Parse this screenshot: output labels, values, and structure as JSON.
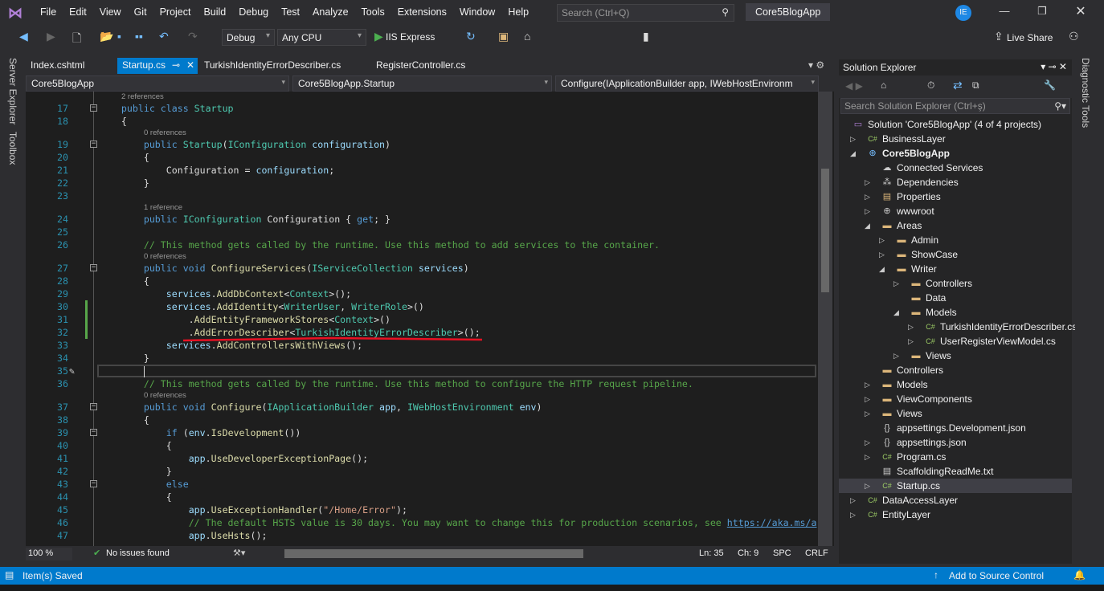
{
  "titlebar": {
    "menu": [
      "File",
      "Edit",
      "View",
      "Git",
      "Project",
      "Build",
      "Debug",
      "Test",
      "Analyze",
      "Tools",
      "Extensions",
      "Window",
      "Help"
    ],
    "search_placeholder": "Search (Ctrl+Q)",
    "app_title": "Core5BlogApp",
    "avatar": "IE"
  },
  "toolbar": {
    "config": "Debug",
    "platform": "Any CPU",
    "run": "IIS Express",
    "live_share": "Live Share"
  },
  "left_strip": [
    "Server Explorer",
    "Toolbox"
  ],
  "tabs": [
    {
      "label": "Index.cshtml"
    },
    {
      "label": "Startup.cs",
      "active": true
    },
    {
      "label": "TurkishIdentityErrorDescriber.cs"
    },
    {
      "label": "RegisterController.cs"
    }
  ],
  "navbar": {
    "project": "Core5BlogApp",
    "type": "Core5BlogApp.Startup",
    "member": "Configure(IApplicationBuilder app, IWebHostEnvironm"
  },
  "code": [
    {
      "lens": "2 references"
    },
    {
      "n": "17",
      "fold": true,
      "code": [
        [
          "p",
          "    "
        ],
        [
          "k",
          "public class "
        ],
        [
          "t",
          "Startup"
        ]
      ]
    },
    {
      "n": "18",
      "code": [
        [
          "p",
          "    {"
        ]
      ]
    },
    {
      "lens": "0 references",
      "indent": 8
    },
    {
      "n": "19",
      "fold": true,
      "code": [
        [
          "p",
          "        "
        ],
        [
          "k",
          "public "
        ],
        [
          "t",
          "Startup"
        ],
        [
          "p",
          "("
        ],
        [
          "t",
          "IConfiguration"
        ],
        [
          "p",
          " "
        ],
        [
          "v",
          "configuration"
        ],
        [
          "p",
          ")"
        ]
      ]
    },
    {
      "n": "20",
      "code": [
        [
          "p",
          "        {"
        ]
      ]
    },
    {
      "n": "21",
      "code": [
        [
          "p",
          "            "
        ],
        [
          "p",
          "Configuration"
        ],
        [
          "p",
          " = "
        ],
        [
          "v",
          "configuration"
        ],
        [
          "p",
          ";"
        ]
      ]
    },
    {
      "n": "22",
      "code": [
        [
          "p",
          "        }"
        ]
      ]
    },
    {
      "n": "23",
      "code": []
    },
    {
      "lens": "1 reference",
      "indent": 8
    },
    {
      "n": "24",
      "code": [
        [
          "p",
          "        "
        ],
        [
          "k",
          "public "
        ],
        [
          "t",
          "IConfiguration"
        ],
        [
          "p",
          " Configuration { "
        ],
        [
          "k",
          "get"
        ],
        [
          "p",
          "; }"
        ]
      ]
    },
    {
      "n": "25",
      "code": []
    },
    {
      "n": "26",
      "code": [
        [
          "p",
          "        "
        ],
        [
          "c",
          "// This method gets called by the runtime. Use this method to add services to the container."
        ]
      ]
    },
    {
      "lens": "0 references",
      "indent": 8
    },
    {
      "n": "27",
      "fold": true,
      "code": [
        [
          "p",
          "        "
        ],
        [
          "k",
          "public void "
        ],
        [
          "m",
          "ConfigureServices"
        ],
        [
          "p",
          "("
        ],
        [
          "t",
          "IServiceCollection"
        ],
        [
          "p",
          " "
        ],
        [
          "v",
          "services"
        ],
        [
          "p",
          ")"
        ]
      ]
    },
    {
      "n": "28",
      "code": [
        [
          "p",
          "        {"
        ]
      ]
    },
    {
      "n": "29",
      "code": [
        [
          "p",
          "            "
        ],
        [
          "v",
          "services"
        ],
        [
          "p",
          "."
        ],
        [
          "m",
          "AddDbContext"
        ],
        [
          "p",
          "<"
        ],
        [
          "t",
          "Context"
        ],
        [
          "p",
          ">();"
        ]
      ]
    },
    {
      "n": "30",
      "code": [
        [
          "p",
          "            "
        ],
        [
          "v",
          "services"
        ],
        [
          "p",
          "."
        ],
        [
          "m",
          "AddIdentity"
        ],
        [
          "p",
          "<"
        ],
        [
          "t",
          "WriterUser"
        ],
        [
          "p",
          ", "
        ],
        [
          "t",
          "WriterRole"
        ],
        [
          "p",
          ">()"
        ]
      ]
    },
    {
      "n": "31",
      "code": [
        [
          "p",
          "                ."
        ],
        [
          "m",
          "AddEntityFrameworkStores"
        ],
        [
          "p",
          "<"
        ],
        [
          "t",
          "Context"
        ],
        [
          "p",
          ">()"
        ]
      ]
    },
    {
      "n": "32",
      "code": [
        [
          "p",
          "                ."
        ],
        [
          "m",
          "AddErrorDescriber"
        ],
        [
          "p",
          "<"
        ],
        [
          "t",
          "TurkishIdentityErrorDescriber"
        ],
        [
          "p",
          ">();"
        ]
      ]
    },
    {
      "n": "33",
      "code": [
        [
          "p",
          "            "
        ],
        [
          "v",
          "services"
        ],
        [
          "p",
          "."
        ],
        [
          "m",
          "AddControllersWithViews"
        ],
        [
          "p",
          "();"
        ]
      ]
    },
    {
      "n": "34",
      "code": [
        [
          "p",
          "        }"
        ]
      ]
    },
    {
      "n": "35",
      "current": true,
      "code": []
    },
    {
      "n": "36",
      "code": [
        [
          "p",
          "        "
        ],
        [
          "c",
          "// This method gets called by the runtime. Use this method to configure the HTTP request pipeline."
        ]
      ]
    },
    {
      "lens": "0 references",
      "indent": 8
    },
    {
      "n": "37",
      "fold": true,
      "code": [
        [
          "p",
          "        "
        ],
        [
          "k",
          "public void "
        ],
        [
          "m",
          "Configure"
        ],
        [
          "p",
          "("
        ],
        [
          "t",
          "IApplicationBuilder"
        ],
        [
          "p",
          " "
        ],
        [
          "v",
          "app"
        ],
        [
          "p",
          ", "
        ],
        [
          "t",
          "IWebHostEnvironment"
        ],
        [
          "p",
          " "
        ],
        [
          "v",
          "env"
        ],
        [
          "p",
          ")"
        ]
      ]
    },
    {
      "n": "38",
      "code": [
        [
          "p",
          "        {"
        ]
      ]
    },
    {
      "n": "39",
      "fold": true,
      "code": [
        [
          "p",
          "            "
        ],
        [
          "k",
          "if"
        ],
        [
          "p",
          " ("
        ],
        [
          "v",
          "env"
        ],
        [
          "p",
          "."
        ],
        [
          "m",
          "IsDevelopment"
        ],
        [
          "p",
          "())"
        ]
      ]
    },
    {
      "n": "40",
      "code": [
        [
          "p",
          "            {"
        ]
      ]
    },
    {
      "n": "41",
      "code": [
        [
          "p",
          "                "
        ],
        [
          "v",
          "app"
        ],
        [
          "p",
          "."
        ],
        [
          "m",
          "UseDeveloperExceptionPage"
        ],
        [
          "p",
          "();"
        ]
      ]
    },
    {
      "n": "42",
      "code": [
        [
          "p",
          "            }"
        ]
      ]
    },
    {
      "n": "43",
      "fold": true,
      "code": [
        [
          "p",
          "            "
        ],
        [
          "k",
          "else"
        ]
      ]
    },
    {
      "n": "44",
      "code": [
        [
          "p",
          "            {"
        ]
      ]
    },
    {
      "n": "45",
      "code": [
        [
          "p",
          "                "
        ],
        [
          "v",
          "app"
        ],
        [
          "p",
          "."
        ],
        [
          "m",
          "UseExceptionHandler"
        ],
        [
          "p",
          "("
        ],
        [
          "s",
          "\"/Home/Error\""
        ],
        [
          "p",
          ");"
        ]
      ]
    },
    {
      "n": "46",
      "code": [
        [
          "p",
          "                "
        ],
        [
          "c",
          "// The default HSTS value is 30 days. You may want to change this for production scenarios, see "
        ],
        [
          "u",
          "https://aka.ms/a"
        ]
      ]
    },
    {
      "n": "47",
      "code": [
        [
          "p",
          "                "
        ],
        [
          "v",
          "app"
        ],
        [
          "p",
          "."
        ],
        [
          "m",
          "UseHsts"
        ],
        [
          "p",
          "();"
        ]
      ]
    }
  ],
  "editor_status": {
    "zoom": "100 %",
    "issues": "No issues found",
    "ln": "Ln: 35",
    "ch": "Ch: 9",
    "spc": "SPC",
    "crlf": "CRLF"
  },
  "solution_explorer": {
    "title": "Solution Explorer",
    "search_placeholder": "Search Solution Explorer (Ctrl+ş)",
    "items": [
      {
        "label": "Solution 'Core5BlogApp' (4 of 4 projects)",
        "level": 0,
        "state": "none",
        "icon": "solution"
      },
      {
        "label": "BusinessLayer",
        "level": 1,
        "state": "collapsed",
        "icon": "csproj"
      },
      {
        "label": "Core5BlogApp",
        "level": 1,
        "state": "expanded",
        "icon": "webproj",
        "bold": true
      },
      {
        "label": "Connected Services",
        "level": 2,
        "state": "none",
        "icon": "connected"
      },
      {
        "label": "Dependencies",
        "level": 2,
        "state": "collapsed",
        "icon": "deps"
      },
      {
        "label": "Properties",
        "level": 2,
        "state": "collapsed",
        "icon": "props"
      },
      {
        "label": "wwwroot",
        "level": 2,
        "state": "collapsed",
        "icon": "globe"
      },
      {
        "label": "Areas",
        "level": 2,
        "state": "expanded",
        "icon": "folder"
      },
      {
        "label": "Admin",
        "level": 3,
        "state": "collapsed",
        "icon": "folder"
      },
      {
        "label": "ShowCase",
        "level": 3,
        "state": "collapsed",
        "icon": "folder"
      },
      {
        "label": "Writer",
        "level": 3,
        "state": "expanded",
        "icon": "folder"
      },
      {
        "label": "Controllers",
        "level": 4,
        "state": "collapsed",
        "icon": "folder"
      },
      {
        "label": "Data",
        "level": 4,
        "state": "none",
        "icon": "folder"
      },
      {
        "label": "Models",
        "level": 4,
        "state": "expanded",
        "icon": "folder"
      },
      {
        "label": "TurkishIdentityErrorDescriber.cs",
        "level": 5,
        "state": "collapsed",
        "icon": "cs"
      },
      {
        "label": "UserRegisterViewModel.cs",
        "level": 5,
        "state": "collapsed",
        "icon": "cs"
      },
      {
        "label": "Views",
        "level": 4,
        "state": "collapsed",
        "icon": "folder"
      },
      {
        "label": "Controllers",
        "level": 2,
        "state": "none",
        "icon": "folder"
      },
      {
        "label": "Models",
        "level": 2,
        "state": "collapsed",
        "icon": "folder"
      },
      {
        "label": "ViewComponents",
        "level": 2,
        "state": "collapsed",
        "icon": "folder"
      },
      {
        "label": "Views",
        "level": 2,
        "state": "collapsed",
        "icon": "folder"
      },
      {
        "label": "appsettings.Development.json",
        "level": 2,
        "state": "none",
        "icon": "json"
      },
      {
        "label": "appsettings.json",
        "level": 2,
        "state": "collapsed",
        "icon": "json"
      },
      {
        "label": "Program.cs",
        "level": 2,
        "state": "collapsed",
        "icon": "cs"
      },
      {
        "label": "ScaffoldingReadMe.txt",
        "level": 2,
        "state": "none",
        "icon": "txt"
      },
      {
        "label": "Startup.cs",
        "level": 2,
        "state": "collapsed",
        "icon": "cs",
        "selected": true
      },
      {
        "label": "DataAccessLayer",
        "level": 1,
        "state": "collapsed",
        "icon": "csproj"
      },
      {
        "label": "EntityLayer",
        "level": 1,
        "state": "collapsed",
        "icon": "csproj"
      }
    ]
  },
  "diagnostic_tools": "Diagnostic Tools",
  "statusbar": {
    "message": "Item(s) Saved",
    "source_control": "Add to Source Control",
    "accent": "#007acc"
  }
}
